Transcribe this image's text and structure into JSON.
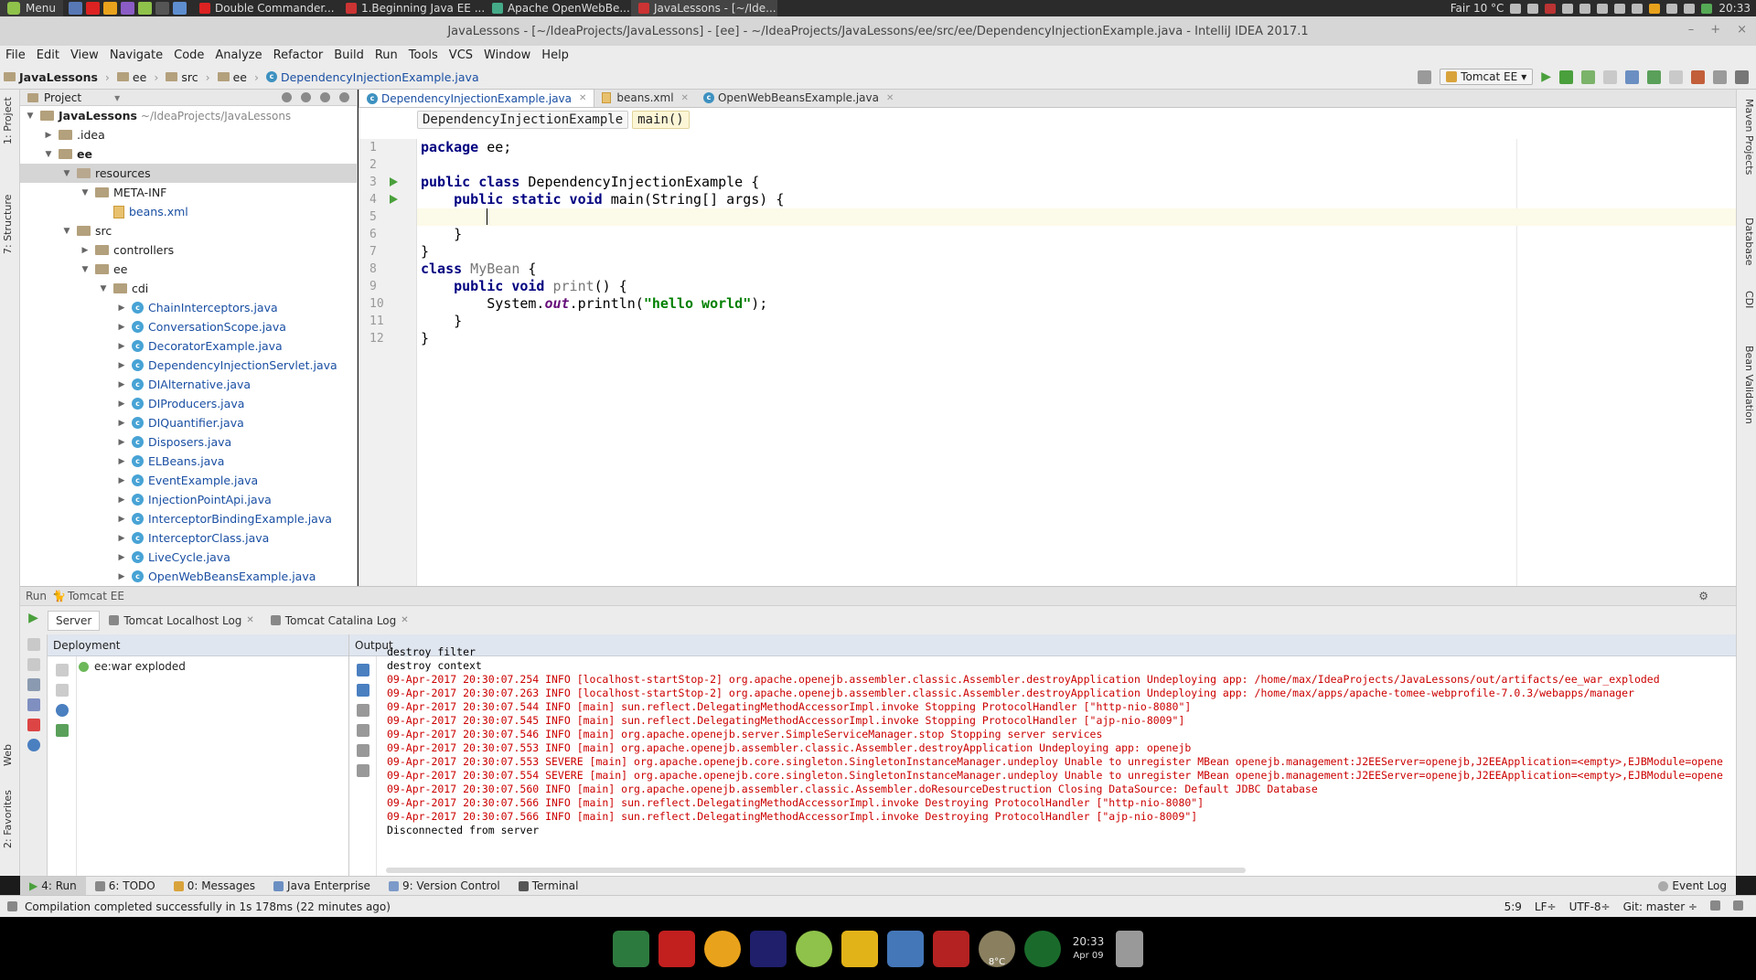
{
  "os_panel": {
    "menu_label": "Menu",
    "tasks": [
      {
        "label": "Double Commander...",
        "color": "#d22"
      },
      {
        "label": "1.Beginning Java EE ...",
        "color": "#c33"
      },
      {
        "label": "Apache OpenWebBe...",
        "color": "#4a8"
      },
      {
        "label": "JavaLessons - [~/Ide...",
        "color": "#c33"
      }
    ],
    "weather": "Fair 10 °C",
    "time": "20:33"
  },
  "window": {
    "title": "JavaLessons - [~/IdeaProjects/JavaLessons] - [ee] - ~/IdeaProjects/JavaLessons/ee/src/ee/DependencyInjectionExample.java - IntelliJ IDEA 2017.1",
    "minimize": "–",
    "maximize": "+",
    "close": "×"
  },
  "menubar": [
    "File",
    "Edit",
    "View",
    "Navigate",
    "Code",
    "Analyze",
    "Refactor",
    "Build",
    "Run",
    "Tools",
    "VCS",
    "Window",
    "Help"
  ],
  "navbar": {
    "crumbs": [
      "JavaLessons",
      "ee",
      "src",
      "ee",
      "DependencyInjectionExample.java"
    ],
    "run_config": "Tomcat EE"
  },
  "project_panel": {
    "title": "Project",
    "tree": [
      {
        "label": "JavaLessons",
        "extra": "~/IdeaProjects/JavaLessons",
        "indent": 0,
        "kind": "root",
        "open": true
      },
      {
        "label": ".idea",
        "indent": 1,
        "kind": "folder",
        "open": false
      },
      {
        "label": "ee",
        "indent": 1,
        "kind": "folder",
        "open": true,
        "bold": true
      },
      {
        "label": "resources",
        "indent": 2,
        "kind": "folder",
        "open": true,
        "selected": true
      },
      {
        "label": "META-INF",
        "indent": 3,
        "kind": "folder",
        "open": true
      },
      {
        "label": "beans.xml",
        "indent": 4,
        "kind": "xml"
      },
      {
        "label": "src",
        "indent": 2,
        "kind": "folder",
        "open": true
      },
      {
        "label": "controllers",
        "indent": 3,
        "kind": "folder",
        "open": false
      },
      {
        "label": "ee",
        "indent": 3,
        "kind": "folder",
        "open": true
      },
      {
        "label": "cdi",
        "indent": 4,
        "kind": "folder",
        "open": true
      },
      {
        "label": "ChainInterceptors.java",
        "indent": 5,
        "kind": "java"
      },
      {
        "label": "ConversationScope.java",
        "indent": 5,
        "kind": "java"
      },
      {
        "label": "DecoratorExample.java",
        "indent": 5,
        "kind": "java"
      },
      {
        "label": "DependencyInjectionServlet.java",
        "indent": 5,
        "kind": "java"
      },
      {
        "label": "DIAlternative.java",
        "indent": 5,
        "kind": "java"
      },
      {
        "label": "DIProducers.java",
        "indent": 5,
        "kind": "java"
      },
      {
        "label": "DIQuantifier.java",
        "indent": 5,
        "kind": "java"
      },
      {
        "label": "Disposers.java",
        "indent": 5,
        "kind": "java"
      },
      {
        "label": "ELBeans.java",
        "indent": 5,
        "kind": "java"
      },
      {
        "label": "EventExample.java",
        "indent": 5,
        "kind": "java"
      },
      {
        "label": "InjectionPointApi.java",
        "indent": 5,
        "kind": "java"
      },
      {
        "label": "InterceptorBindingExample.java",
        "indent": 5,
        "kind": "java"
      },
      {
        "label": "InterceptorClass.java",
        "indent": 5,
        "kind": "java"
      },
      {
        "label": "LiveCycle.java",
        "indent": 5,
        "kind": "java"
      },
      {
        "label": "OpenWebBeansExample.java",
        "indent": 5,
        "kind": "java"
      }
    ]
  },
  "editor": {
    "tabs": [
      {
        "label": "DependencyInjectionExample.java",
        "active": true
      },
      {
        "label": "beans.xml",
        "active": false
      },
      {
        "label": "OpenWebBeansExample.java",
        "active": false
      }
    ],
    "breadcrumbs": [
      "DependencyInjectionExample",
      "main()"
    ],
    "line_numbers": [
      "1",
      "2",
      "3",
      "4",
      "5",
      "6",
      "7",
      "8",
      "9",
      "10",
      "11",
      "12"
    ],
    "code": {
      "l1_kw": "package",
      "l1_rest": " ee;",
      "l3_kw": "public class",
      "l3_rest": " DependencyInjectionExample {",
      "l4_indent": "    ",
      "l4_kw": "public static void",
      "l4_rest": " main(String[] args) {",
      "l6": "    }",
      "l7": "}",
      "l8_kw": "class",
      "l8_name": " MyBean",
      "l8_rest": " {",
      "l9_indent": "    ",
      "l9_kw": "public void",
      "l9_name": " print",
      "l9_rest": "() {",
      "l10_pre": "        System.",
      "l10_field": "out",
      "l10_mid": ".println(",
      "l10_str": "\"hello world\"",
      "l10_end": ");",
      "l11": "    }",
      "l12": "}"
    }
  },
  "run_window": {
    "header": "Run",
    "config": "Tomcat EE",
    "tabs": [
      {
        "label": "Server",
        "active": true
      },
      {
        "label": "Tomcat Localhost Log",
        "active": false
      },
      {
        "label": "Tomcat Catalina Log",
        "active": false
      }
    ],
    "deployment_title": "Deployment",
    "deployment_item": "ee:war exploded",
    "output_title": "Output",
    "output_lines": [
      {
        "text": "destroy filter",
        "plain": true
      },
      {
        "text": "destroy context",
        "plain": true
      },
      {
        "text": "09-Apr-2017 20:30:07.254 INFO [localhost-startStop-2] org.apache.openejb.assembler.classic.Assembler.destroyApplication Undeploying app: /home/max/IdeaProjects/JavaLessons/out/artifacts/ee_war_exploded",
        "plain": false
      },
      {
        "text": "09-Apr-2017 20:30:07.263 INFO [localhost-startStop-2] org.apache.openejb.assembler.classic.Assembler.destroyApplication Undeploying app: /home/max/apps/apache-tomee-webprofile-7.0.3/webapps/manager",
        "plain": false
      },
      {
        "text": "09-Apr-2017 20:30:07.544 INFO [main] sun.reflect.DelegatingMethodAccessorImpl.invoke Stopping ProtocolHandler [\"http-nio-8080\"]",
        "plain": false
      },
      {
        "text": "09-Apr-2017 20:30:07.545 INFO [main] sun.reflect.DelegatingMethodAccessorImpl.invoke Stopping ProtocolHandler [\"ajp-nio-8009\"]",
        "plain": false
      },
      {
        "text": "09-Apr-2017 20:30:07.546 INFO [main] org.apache.openejb.server.SimpleServiceManager.stop Stopping server services",
        "plain": false
      },
      {
        "text": "09-Apr-2017 20:30:07.553 INFO [main] org.apache.openejb.assembler.classic.Assembler.destroyApplication Undeploying app: openejb",
        "plain": false
      },
      {
        "text": "09-Apr-2017 20:30:07.553 SEVERE [main] org.apache.openejb.core.singleton.SingletonInstanceManager.undeploy Unable to unregister MBean openejb.management:J2EEServer=openejb,J2EEApplication=<empty>,EJBModule=opene",
        "plain": false
      },
      {
        "text": "09-Apr-2017 20:30:07.554 SEVERE [main] org.apache.openejb.core.singleton.SingletonInstanceManager.undeploy Unable to unregister MBean openejb.management:J2EEServer=openejb,J2EEApplication=<empty>,EJBModule=opene",
        "plain": false
      },
      {
        "text": "09-Apr-2017 20:30:07.560 INFO [main] org.apache.openejb.assembler.classic.Assembler.doResourceDestruction Closing DataSource: Default JDBC Database",
        "plain": false
      },
      {
        "text": "09-Apr-2017 20:30:07.566 INFO [main] sun.reflect.DelegatingMethodAccessorImpl.invoke Destroying ProtocolHandler [\"http-nio-8080\"]",
        "plain": false
      },
      {
        "text": "09-Apr-2017 20:30:07.566 INFO [main] sun.reflect.DelegatingMethodAccessorImpl.invoke Destroying ProtocolHandler [\"ajp-nio-8009\"]",
        "plain": false
      },
      {
        "text": "Disconnected from server",
        "plain": true
      }
    ]
  },
  "tool_tabs": [
    "4: Run",
    "6: TODO",
    "0: Messages",
    "Java Enterprise",
    "9: Version Control",
    "Terminal"
  ],
  "event_log": "Event Log",
  "status": {
    "message": "Compilation completed successfully in 1s 178ms (22 minutes ago)",
    "position": "5:9",
    "line_sep": "LF÷",
    "encoding": "UTF-8÷",
    "vcs": "Git: master ÷"
  },
  "left_strip": [
    "1: Project",
    "7: Structure",
    "Web",
    "2: Favorites"
  ],
  "right_strip": [
    "Maven Projects",
    "Database",
    "CDI",
    "Bean Validation"
  ],
  "dock": {
    "time": "20:33",
    "date": "Apr 09",
    "weather": "8°C"
  }
}
